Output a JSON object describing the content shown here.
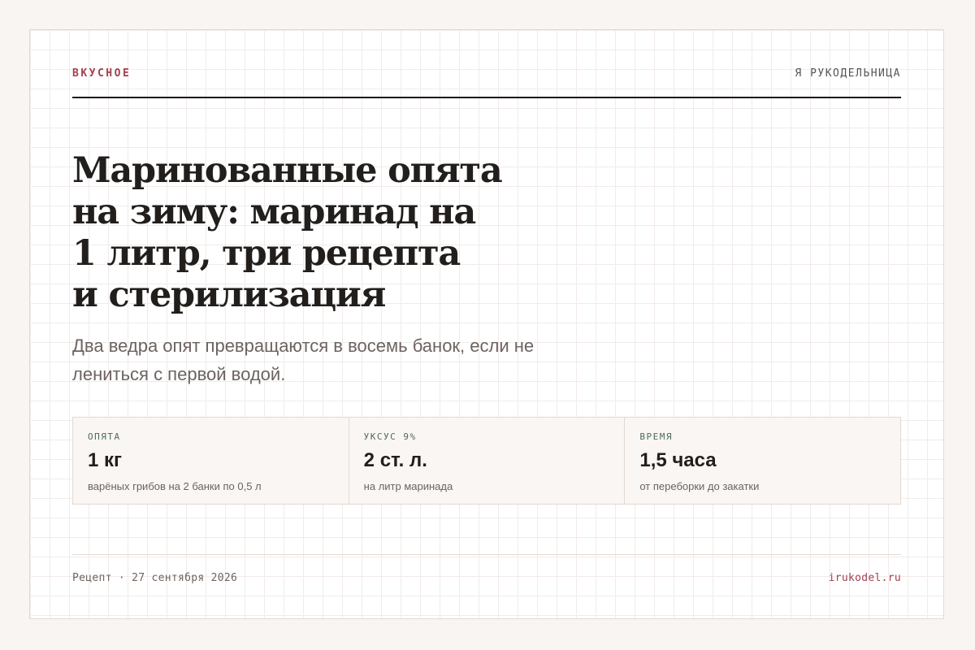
{
  "header": {
    "section": "ВКУСНОЕ",
    "site": "Я РУКОДЕЛЬНИЦА"
  },
  "article": {
    "title": "Маринованные опята\nна зиму: маринад на\n1 литр, три рецепта\nи стерилизация",
    "lead": "Два ведра опят превращаются в восемь банок, если не лениться с первой водой."
  },
  "stats": [
    {
      "label": "ОПЯТА",
      "value": "1 кг",
      "note": "варёных грибов на 2 банки по 0,5 л"
    },
    {
      "label": "УКСУС 9%",
      "value": "2 ст. л.",
      "note": "на литр маринада"
    },
    {
      "label": "ВРЕМЯ",
      "value": "1,5 часа",
      "note": "от переборки до закатки"
    }
  ],
  "footer": {
    "meta": "Рецепт · 27 сентября 2026",
    "domain": "irukodel.ru"
  },
  "colors": {
    "accent": "#a3404f",
    "label_green": "#4d6b57",
    "text": "#221e1c",
    "muted": "#6c6360",
    "border": "#e4d9d3",
    "page_bg": "#f8f5f2"
  }
}
